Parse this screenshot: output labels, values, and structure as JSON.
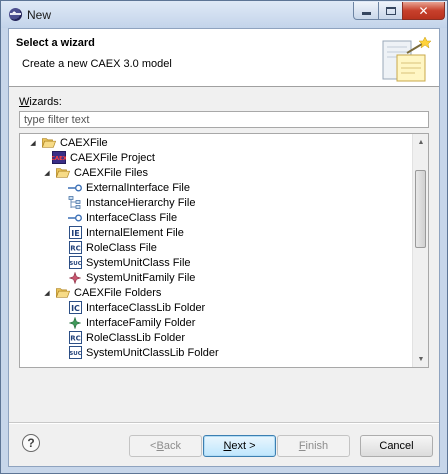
{
  "window": {
    "title": "New"
  },
  "banner": {
    "title": "Select a wizard",
    "subtitle": "Create a new CAEX 3.0 model"
  },
  "wizards": {
    "label_mnemonic": "W",
    "label_rest": "izards:",
    "filter_placeholder": "type filter text"
  },
  "tree": {
    "items": [
      {
        "label": "CAEXFile",
        "icon": "folder-open-icon",
        "expanded": true
      },
      {
        "label": "CAEXFile Project",
        "icon": "caex-project-icon"
      },
      {
        "label": "CAEXFile Files",
        "icon": "folder-open-icon",
        "expanded": true
      },
      {
        "label": "ExternalInterface File",
        "icon": "external-interface-icon"
      },
      {
        "label": "InstanceHierarchy File",
        "icon": "instance-hierarchy-icon"
      },
      {
        "label": "InterfaceClass File",
        "icon": "interface-class-icon"
      },
      {
        "label": "InternalElement File",
        "icon": "internal-element-icon"
      },
      {
        "label": "RoleClass File",
        "icon": "role-class-icon"
      },
      {
        "label": "SystemUnitClass File",
        "icon": "system-unit-class-icon"
      },
      {
        "label": "SystemUnitFamily File",
        "icon": "system-unit-family-icon"
      },
      {
        "label": "CAEXFile Folders",
        "icon": "folder-open-icon",
        "expanded": true
      },
      {
        "label": "InterfaceClassLib Folder",
        "icon": "interface-class-lib-icon"
      },
      {
        "label": "InterfaceFamily Folder",
        "icon": "interface-family-icon"
      },
      {
        "label": "RoleClassLib Folder",
        "icon": "role-class-lib-icon"
      },
      {
        "label": "SystemUnitClassLib Folder",
        "icon": "system-unit-class-lib-icon"
      }
    ]
  },
  "buttons": {
    "help": "?",
    "back_prefix": "< ",
    "back_mnemonic": "B",
    "back_rest": "ack",
    "next_mnemonic": "N",
    "next_rest": "ext >",
    "finish_mnemonic": "F",
    "finish_rest": "inish",
    "cancel": "Cancel"
  }
}
